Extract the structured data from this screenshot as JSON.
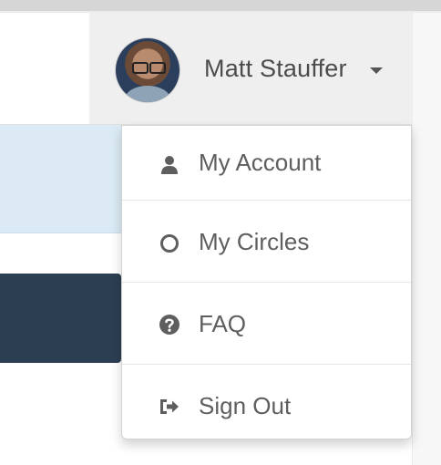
{
  "user": {
    "name": "Matt Stauffer"
  },
  "menu": {
    "items": [
      {
        "label": "My Account",
        "icon": "user-icon"
      },
      {
        "label": "My Circles",
        "icon": "circle-icon"
      },
      {
        "label": "FAQ",
        "icon": "question-circle-icon"
      },
      {
        "label": "Sign Out",
        "icon": "sign-out-icon"
      }
    ]
  },
  "colors": {
    "navbar_bg": "#efefef",
    "alert_bg": "#dbeaf4",
    "dark_panel": "#2c3e51",
    "text": "#5e5e5e"
  }
}
